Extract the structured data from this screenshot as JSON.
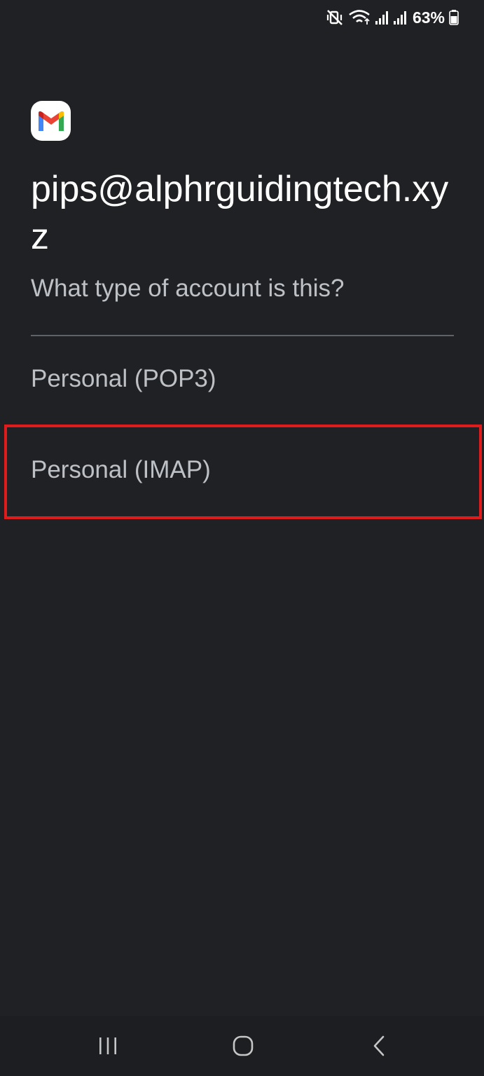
{
  "status_bar": {
    "icons": [
      "mute-vibrate-icon",
      "wifi-icon",
      "signal-icon-1",
      "signal-icon-2",
      "battery-icon"
    ],
    "battery_percent": "63%"
  },
  "app": {
    "logo_icon": "gmail-logo-icon",
    "colors": {
      "blue": "#4285F4",
      "red": "#EA4335",
      "yellow": "#FBBC04",
      "green": "#34A853",
      "highlight": "#E01B1B",
      "background": "#202124"
    }
  },
  "header": {
    "email": "pips@alphrguidingtech.xyz",
    "question": "What type of account is this?"
  },
  "options": [
    {
      "label": "Personal (POP3)"
    },
    {
      "label": "Personal (IMAP)",
      "highlighted": true
    }
  ],
  "nav_bar": {
    "recents_icon": "recents-icon",
    "home_icon": "home-icon",
    "back_icon": "back-icon"
  }
}
